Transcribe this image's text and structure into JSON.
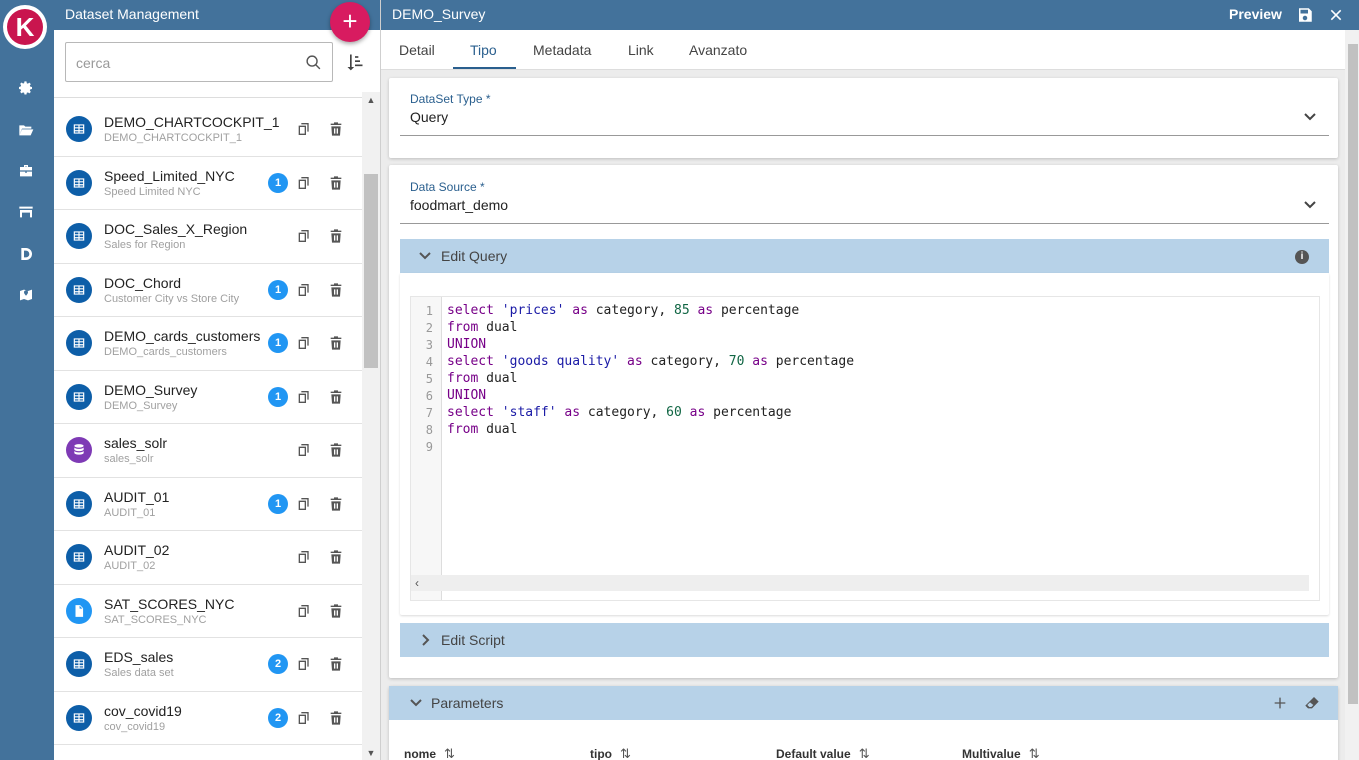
{
  "list_panel": {
    "title": "Dataset Management",
    "add_label": "+",
    "search_placeholder": "cerca",
    "items": [
      {
        "name": "DEMO_CHARTCOCKPIT_1",
        "sub": "DEMO_CHARTCOCKPIT_1",
        "type": "table",
        "badge": ""
      },
      {
        "name": "Speed_Limited_NYC",
        "sub": "Speed Limited NYC",
        "type": "table",
        "badge": "1"
      },
      {
        "name": "DOC_Sales_X_Region",
        "sub": "Sales for Region",
        "type": "table",
        "badge": ""
      },
      {
        "name": "DOC_Chord",
        "sub": "Customer City vs Store City",
        "type": "table",
        "badge": "1"
      },
      {
        "name": "DEMO_cards_customers",
        "sub": "DEMO_cards_customers",
        "type": "table",
        "badge": "1"
      },
      {
        "name": "DEMO_Survey",
        "sub": "DEMO_Survey",
        "type": "table",
        "badge": "1"
      },
      {
        "name": "sales_solr",
        "sub": "sales_solr",
        "type": "db",
        "badge": ""
      },
      {
        "name": "AUDIT_01",
        "sub": "AUDIT_01",
        "type": "table",
        "badge": "1"
      },
      {
        "name": "AUDIT_02",
        "sub": "AUDIT_02",
        "type": "table",
        "badge": ""
      },
      {
        "name": "SAT_SCORES_NYC",
        "sub": "SAT_SCORES_NYC",
        "type": "file",
        "badge": ""
      },
      {
        "name": "EDS_sales",
        "sub": "Sales data set",
        "type": "table",
        "badge": "2"
      },
      {
        "name": "cov_covid19",
        "sub": "cov_covid19",
        "type": "table",
        "badge": "2"
      }
    ]
  },
  "detail": {
    "title": "DEMO_Survey",
    "preview_label": "Preview",
    "tabs": [
      "Detail",
      "Tipo",
      "Metadata",
      "Link",
      "Avanzato"
    ],
    "active_tab": "Tipo",
    "dataset_type": {
      "label": "DataSet Type *",
      "value": "Query"
    },
    "data_source": {
      "label": "Data Source *",
      "value": "foodmart_demo"
    },
    "edit_query_title": "Edit Query",
    "edit_script_title": "Edit Script",
    "parameters_title": "Parameters",
    "line_numbers": [
      "1",
      "2",
      "3",
      "4",
      "5",
      "6",
      "7",
      "8",
      "9"
    ],
    "query_lines": [
      "select 'prices' as category, 85 as percentage",
      "from dual",
      "UNION",
      "select 'goods quality' as category, 70 as percentage",
      "from dual",
      "UNION",
      "select 'staff' as category, 60 as percentage",
      "from dual",
      ""
    ],
    "param_columns": [
      "nome",
      "tipo",
      "Default value",
      "Multivalue"
    ]
  },
  "colors": {
    "header_blue": "#43729b",
    "accent_pink": "#d81b60",
    "section_blue": "#b7d2e8",
    "badge_blue": "#2196f3",
    "avatar_blue": "#0d5ea8",
    "avatar_purple": "#7e3ab5"
  }
}
